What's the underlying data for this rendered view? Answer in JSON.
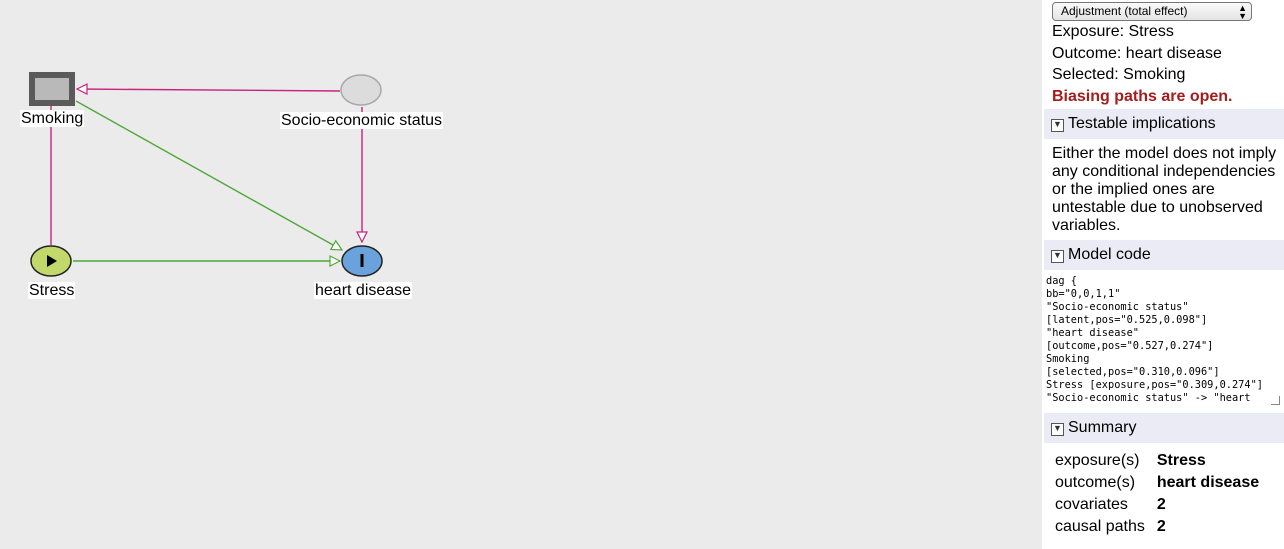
{
  "diagram": {
    "nodes": {
      "smoking": {
        "label": "Smoking",
        "role": "selected"
      },
      "ses": {
        "label": "Socio-economic status",
        "role": "latent"
      },
      "stress": {
        "label": "Stress",
        "role": "exposure"
      },
      "heart": {
        "label": "heart disease",
        "role": "outcome"
      }
    },
    "colors": {
      "biasing_edge": "#c8237f",
      "causal_edge": "#4fa83a",
      "exposure_fill": "#c3d86b",
      "outcome_fill": "#6aa2dc",
      "latent_fill": "#dcdcdc",
      "selected_fill": "#b9b9b9",
      "selected_border": "#5a5a5a"
    }
  },
  "panel": {
    "mode_select": {
      "value": "Adjustment (total effect)"
    },
    "info": {
      "exposure": "Exposure: Stress",
      "outcome": "Outcome: heart disease",
      "selected": "Selected: Smoking",
      "warning": "Biasing paths are open."
    },
    "sections": {
      "implications": {
        "title": "Testable implications",
        "text": "Either the model does not imply any conditional independencies or the implied ones are untestable due to unobserved variables."
      },
      "model_code": {
        "title": "Model code",
        "code": "dag {\nbb=\"0,0,1,1\"\n\"Socio-economic status\"\n[latent,pos=\"0.525,0.098\"]\n\"heart disease\"\n[outcome,pos=\"0.527,0.274\"]\nSmoking\n[selected,pos=\"0.310,0.096\"]\nStress [exposure,pos=\"0.309,0.274\"]\n\"Socio-economic status\" -> \"heart"
      },
      "summary": {
        "title": "Summary",
        "rows": [
          {
            "key": "exposure(s)",
            "value": "Stress"
          },
          {
            "key": "outcome(s)",
            "value": "heart disease"
          },
          {
            "key": "covariates",
            "value": "2"
          },
          {
            "key": "causal paths",
            "value": "2"
          }
        ]
      }
    }
  }
}
